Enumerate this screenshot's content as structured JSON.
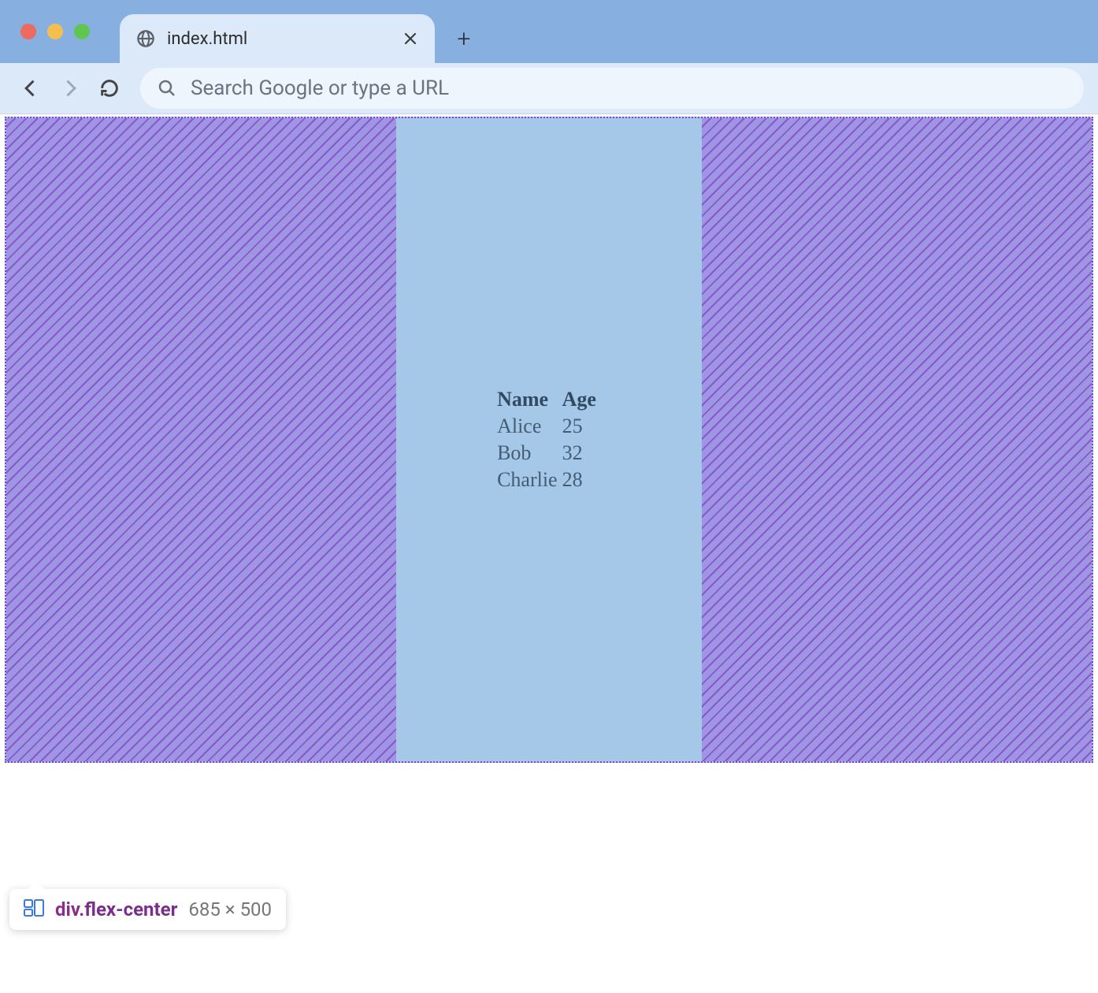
{
  "browser": {
    "tab_title": "index.html",
    "omnibox_placeholder": "Search Google or type a URL"
  },
  "table": {
    "headers": {
      "col1": "Name",
      "col2": "Age"
    },
    "rows": [
      {
        "name": "Alice",
        "age": "25"
      },
      {
        "name": "Bob",
        "age": "32"
      },
      {
        "name": "Charlie",
        "age": "28"
      }
    ]
  },
  "devtools_tooltip": {
    "tag": "div",
    "cls": ".flex-center",
    "dims": "685 × 500"
  }
}
